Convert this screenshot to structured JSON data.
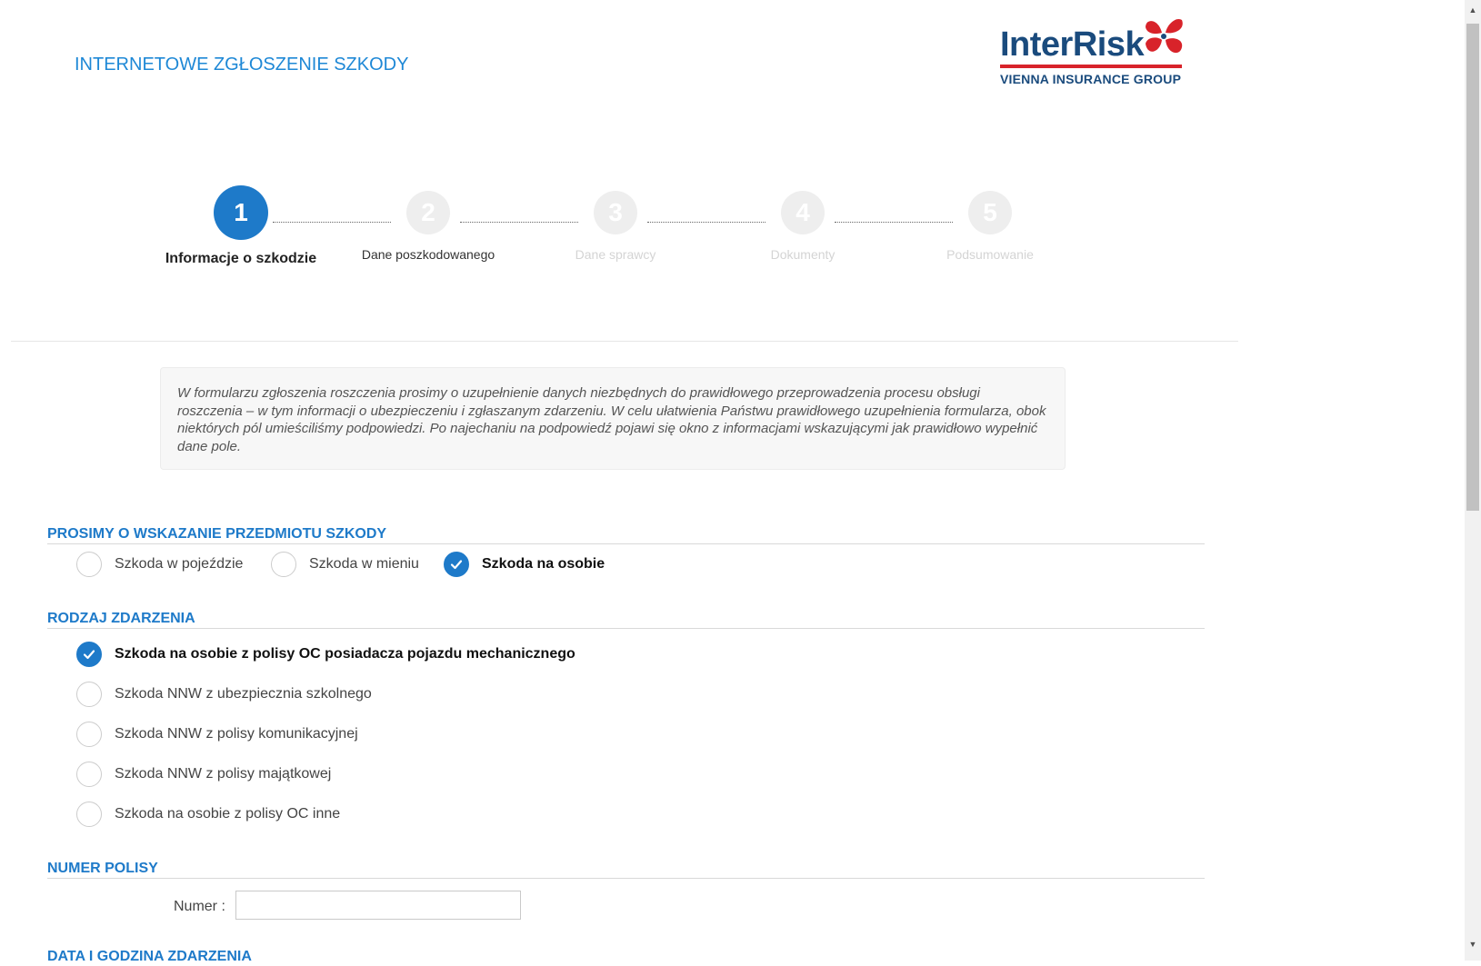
{
  "header": {
    "title": "INTERNETOWE ZGŁOSZENIE SZKODY",
    "logo": {
      "wordmark": "InterRisk",
      "tagline": "VIENNA INSURANCE GROUP",
      "mark_icon": "butterfly-logo-icon"
    }
  },
  "stepper": {
    "current_step": 1,
    "steps": [
      {
        "number": "1",
        "label": "Informacje o szkodzie",
        "state": "active"
      },
      {
        "number": "2",
        "label": "Dane poszkodowanego",
        "state": "next"
      },
      {
        "number": "3",
        "label": "Dane sprawcy",
        "state": "disabled"
      },
      {
        "number": "4",
        "label": "Dokumenty",
        "state": "disabled"
      },
      {
        "number": "5",
        "label": "Podsumowanie",
        "state": "disabled"
      }
    ]
  },
  "info_text": "W formularzu zgłoszenia roszczenia prosimy o uzupełnienie danych niezbędnych do prawidłowego przeprowadzenia procesu obsługi roszczenia – w tym informacji o ubezpieczeniu i zgłaszanym zdarzeniu. W celu ułatwienia Państwu prawidłowego uzupełnienia formularza, obok niektórych pól umieściliśmy podpowiedzi. Po najechaniu na  podpowiedź pojawi się okno z informacjami wskazującymi jak prawidłowo wypełnić dane pole.",
  "damage_subject": {
    "heading": "PROSIMY O WSKAZANIE PRZEDMIOTU SZKODY",
    "options": [
      {
        "label": "Szkoda w pojeździe",
        "checked": false
      },
      {
        "label": "Szkoda w mieniu",
        "checked": false
      },
      {
        "label": "Szkoda na osobie",
        "checked": true
      }
    ]
  },
  "event_type": {
    "heading": "RODZAJ ZDARZENIA",
    "options": [
      {
        "label": "Szkoda na osobie z polisy OC posiadacza pojazdu mechanicznego",
        "checked": true
      },
      {
        "label": "Szkoda NNW z ubezpiecznia szkolnego",
        "checked": false
      },
      {
        "label": "Szkoda NNW z polisy komunikacyjnej",
        "checked": false
      },
      {
        "label": "Szkoda NNW z polisy majątkowej",
        "checked": false
      },
      {
        "label": "Szkoda na osobie z polisy OC inne",
        "checked": false
      }
    ]
  },
  "policy": {
    "heading": "NUMER POLISY",
    "number_label": "Numer :",
    "number_value": ""
  },
  "next_section_heading": "DATA I GODZINA ZDARZENIA",
  "colors": {
    "accent": "#1e7ac9",
    "title_blue": "#1e88d6",
    "logo_navy": "#1a4b7d",
    "logo_red": "#d8232a"
  }
}
